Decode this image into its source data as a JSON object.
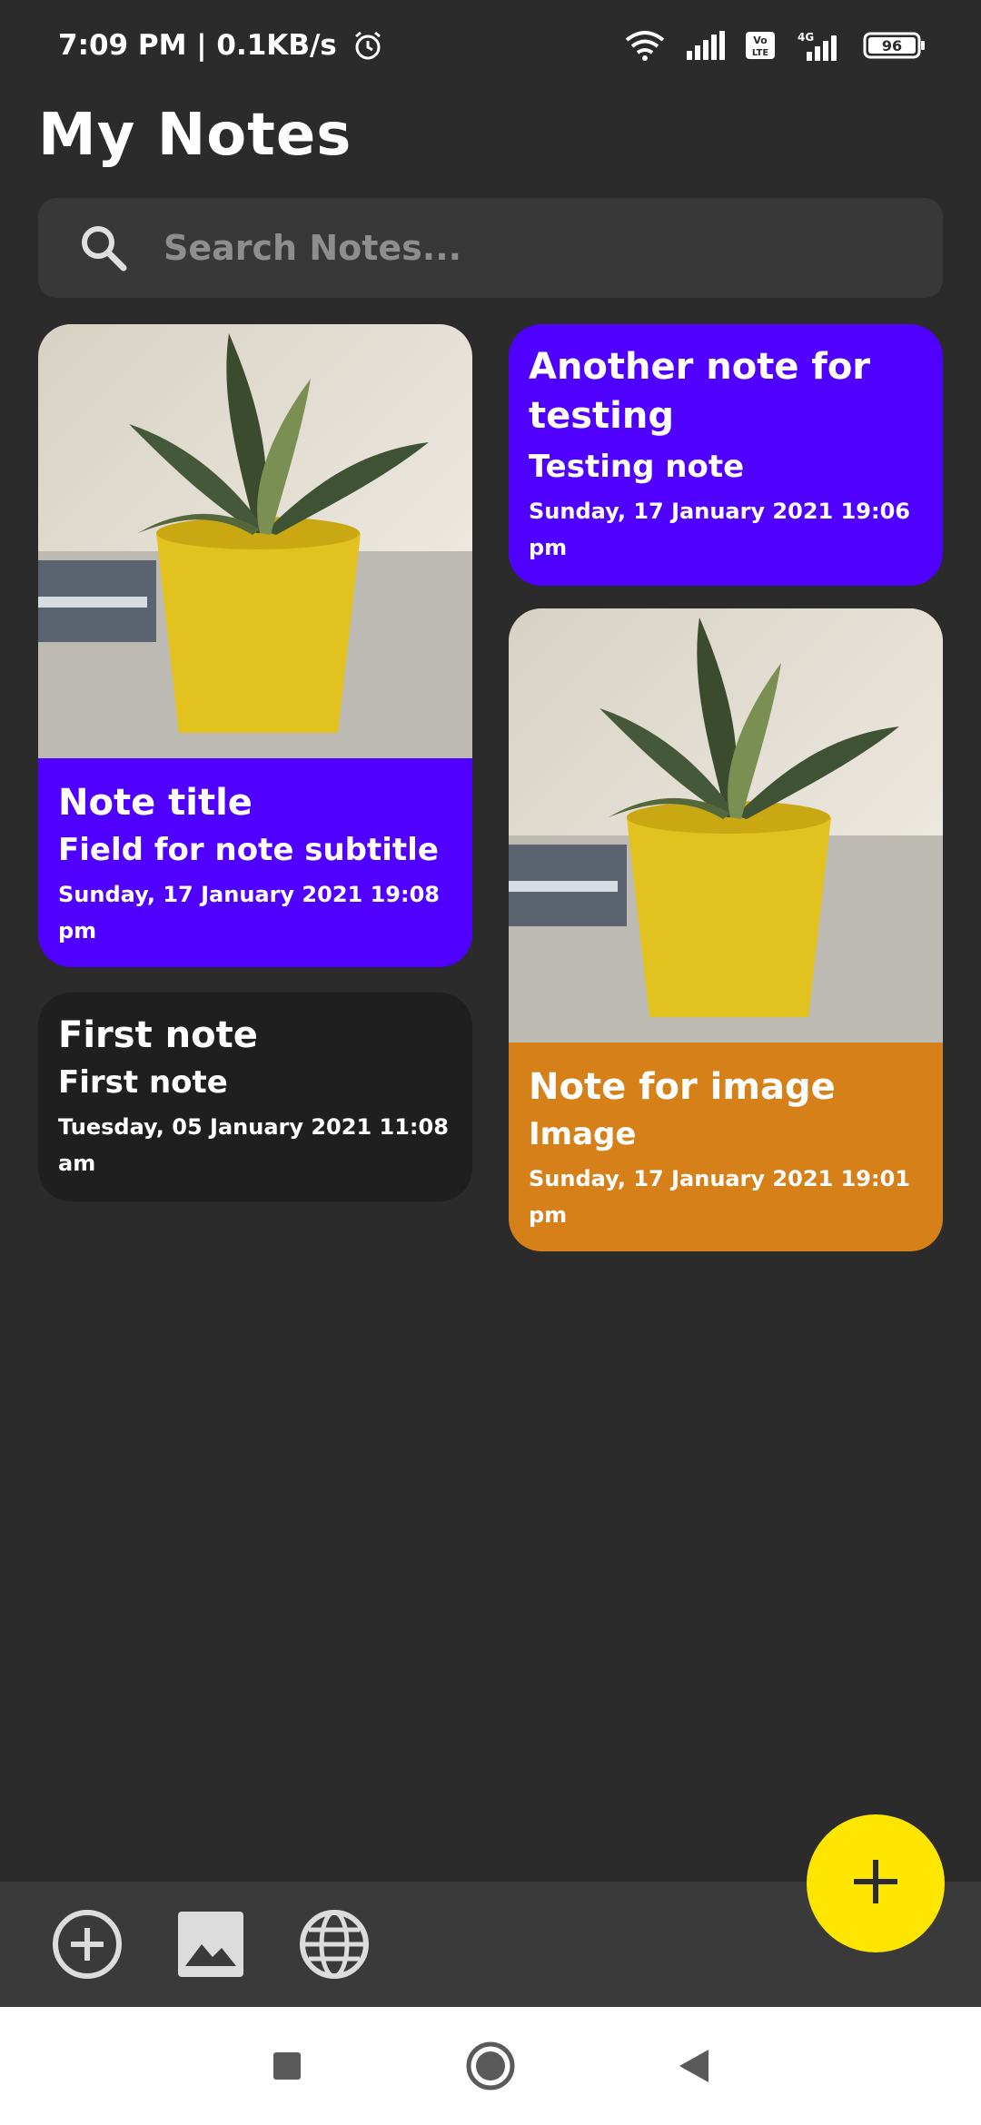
{
  "status_bar": {
    "time_speed": "7:09 PM | 0.1KB/s",
    "network_tag": "4G",
    "volte": "Vo LTE",
    "battery": "96"
  },
  "header": {
    "title": "My Notes"
  },
  "search": {
    "placeholder": "Search Notes..."
  },
  "notes": [
    {
      "title": "Note title",
      "subtitle": "Field for note subtitle",
      "date": "Sunday, 17 January 2021 19:08 pm",
      "color": "#4f00ff",
      "has_image": true
    },
    {
      "title": "Another note for testing",
      "subtitle": "Testing note",
      "date": "Sunday, 17 January 2021 19:06 pm",
      "color": "#4f00ff",
      "has_image": false
    },
    {
      "title": "First note",
      "subtitle": "First note",
      "date": "Tuesday, 05 January 2021 11:08 am",
      "color": "#1f1f1f",
      "has_image": false
    },
    {
      "title": "Note for image",
      "subtitle": "Image",
      "date": "Sunday, 17 January 2021 19:01 pm",
      "color": "#d6801a",
      "has_image": true
    }
  ],
  "bottom_bar": {
    "icons": [
      "add-circle-icon",
      "image-icon",
      "globe-icon"
    ]
  },
  "fab": {
    "icon": "plus-icon",
    "color": "#ffe600"
  },
  "system_nav": {
    "icons": [
      "recents-square-icon",
      "home-circle-icon",
      "back-triangle-icon"
    ]
  }
}
